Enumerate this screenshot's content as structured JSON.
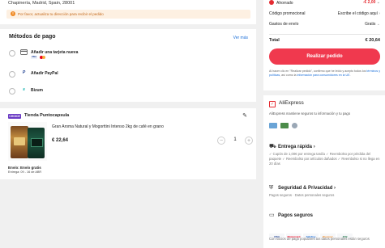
{
  "address": {
    "line": "Chapinería, Madrid, Spain, 28001",
    "notice": "Por favor, actualiza tu dirección para recibir el pedido"
  },
  "payment": {
    "title": "Métodos de pago",
    "more": "Ver más",
    "methods": [
      {
        "label": "Añadir una tarjeta nueva"
      },
      {
        "label": "Añadir PayPal"
      },
      {
        "label": "Bizum"
      }
    ],
    "card_brands": [
      "VISA",
      "Mastercard"
    ]
  },
  "store": {
    "badge": "CHOICE",
    "name": "Tienda Puntocapsula",
    "product": "Gran Aroma Natural y Mogorttini Intenso 2kg de café en grano",
    "price": "€ 22,64",
    "qty": "1",
    "minus": "−",
    "plus": "+",
    "ship_title": "Envío: Envío gratis",
    "ship_date": "Entrega: 09 - 16 de ABR"
  },
  "summary": {
    "saved_label": "Ahorrado",
    "saved_value": "-€ 2,00",
    "promo_label": "Código promocional",
    "promo_value": "Escribe el código aquí",
    "shipping_label": "Gastos de envío",
    "shipping_value": "Gratis",
    "total_label": "Total",
    "total_value": "€ 20,64",
    "button": "Realizar pedido",
    "legal_a": "Al hacer clic en \"Realizar pedido\", confirmo que he leído y acepto todos los ",
    "legal_link1": "términos y políticas",
    "legal_b": ", así como la ",
    "legal_link2": "información para consumidores en la UE",
    "legal_c": "."
  },
  "trust": {
    "brand": "AliExpress",
    "brand_sub": "AliExpress mantiene seguros tu información y tu pago",
    "delivery_title": "Entrega rápida",
    "delivery_body": "✓ Cupón de 1,00€ por entrega tardía  ✓ Reembolso por pérdida del paquete  ✓ Reembolso por artículos dañados  ✓ Reembolso si no llega en 20 días",
    "security_title": "Seguridad & Privacidad",
    "security_body": "Pagos seguros · Datos personales seguros",
    "payments_title": "Pagos seguros",
    "payments_body": "Con socios de pago populares tus datos personales están seguros",
    "pay_logos": [
      "VISA",
      "Mastercard",
      "SafeKey",
      "Discover",
      "JCB"
    ]
  },
  "colors": {
    "accent": "#f0394e",
    "brand_red": "#e42b31",
    "link": "#1a6ed8",
    "notice_bg": "#fdf0e2"
  }
}
